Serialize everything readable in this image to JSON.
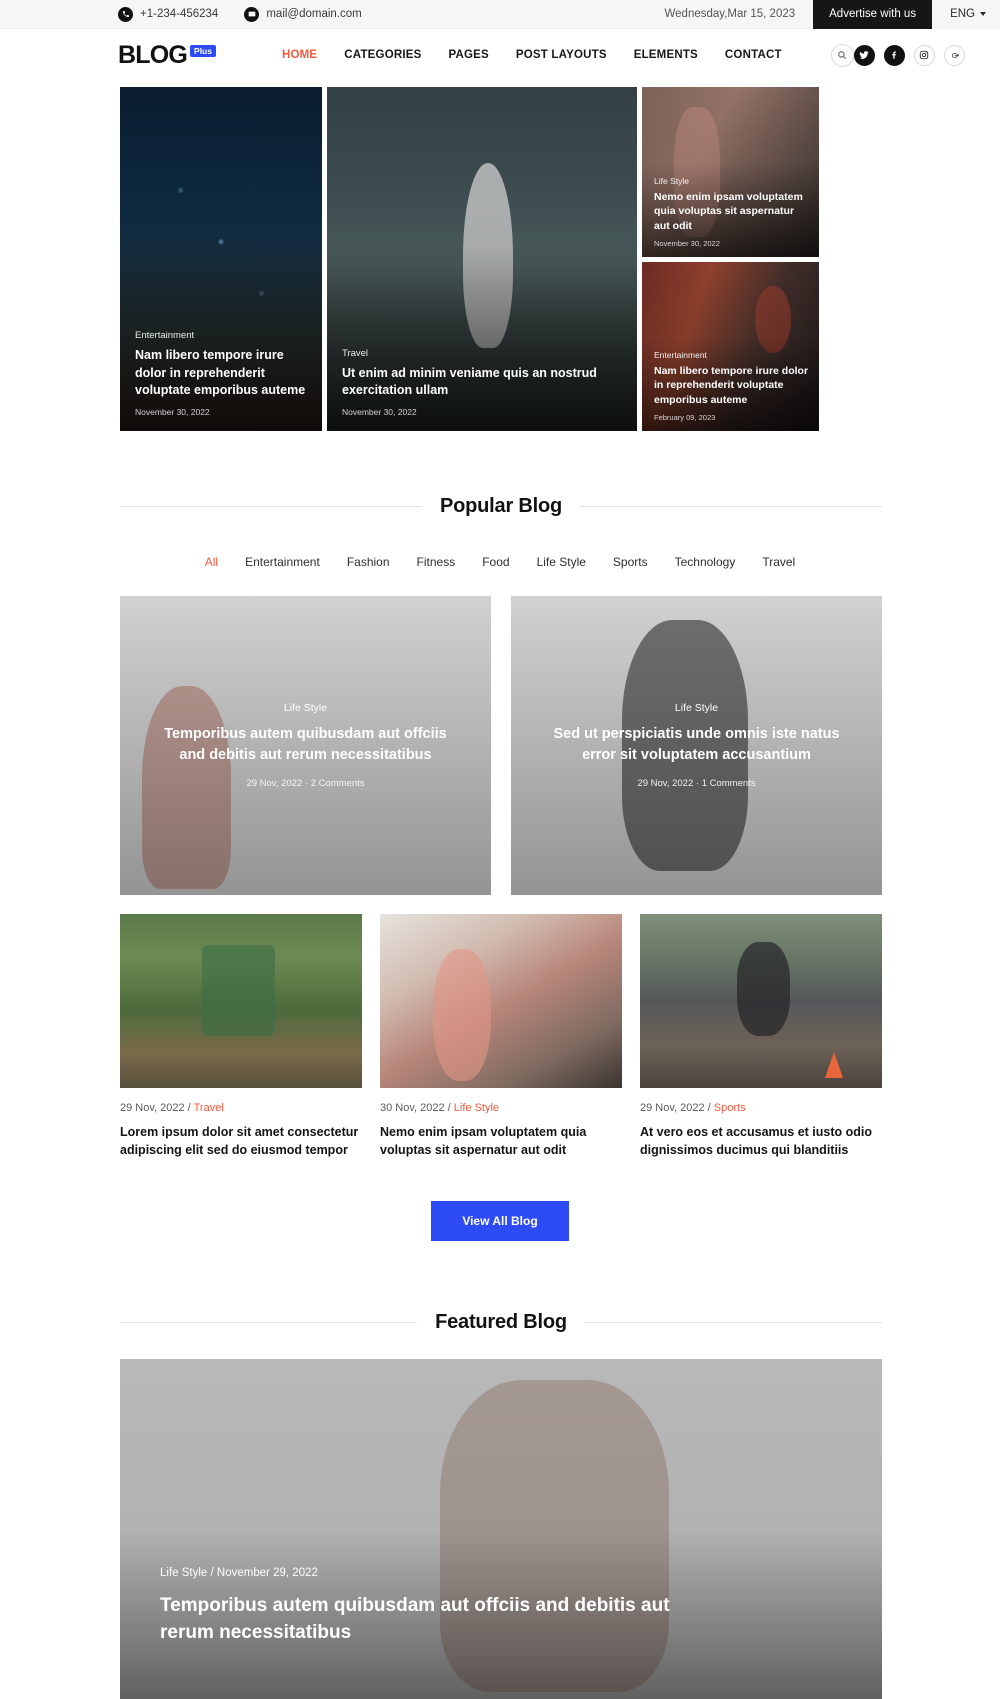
{
  "topbar": {
    "phone": "+1-234-456234",
    "email": "mail@domain.com",
    "date": "Wednesday,Mar 15, 2023",
    "advertise": "Advertise with us",
    "language": "ENG"
  },
  "nav": {
    "logo_text": "BLOG",
    "logo_badge": "Plus",
    "links": [
      {
        "label": "HOME",
        "active": true
      },
      {
        "label": "CATEGORIES",
        "active": false
      },
      {
        "label": "PAGES",
        "active": false
      },
      {
        "label": "POST LAYOUTS",
        "active": false
      },
      {
        "label": "ELEMENTS",
        "active": false
      },
      {
        "label": "CONTACT",
        "active": false
      }
    ],
    "social": [
      "twitter-icon",
      "facebook-icon",
      "instagram-icon",
      "google-plus-icon"
    ],
    "accent": "#f2593b",
    "brand": "#2d4cf5"
  },
  "hero": {
    "left": {
      "category": "Entertainment",
      "title": "Nam libero tempore irure dolor in reprehenderit voluptate emporibus auteme",
      "date": "November 30, 2022"
    },
    "middle": {
      "category": "Travel",
      "title": "Ut enim ad minim veniame quis an nostrud exercitation ullam",
      "date": "November 30, 2022"
    },
    "right_top": {
      "category": "Life Style",
      "title": "Nemo enim ipsam voluptatem quia voluptas sit aspernatur aut odit",
      "date": "November 30, 2022"
    },
    "right_bottom": {
      "category": "Entertainment",
      "title": "Nam libero tempore irure dolor in reprehenderit voluptate emporibus auteme",
      "date": "February 09, 2023"
    }
  },
  "popular": {
    "heading": "Popular Blog",
    "filters": [
      {
        "label": "All",
        "active": true
      },
      {
        "label": "Entertainment",
        "active": false
      },
      {
        "label": "Fashion",
        "active": false
      },
      {
        "label": "Fitness",
        "active": false
      },
      {
        "label": "Food",
        "active": false
      },
      {
        "label": "Life Style",
        "active": false
      },
      {
        "label": "Sports",
        "active": false
      },
      {
        "label": "Technology",
        "active": false
      },
      {
        "label": "Travel",
        "active": false
      }
    ],
    "big_cards": [
      {
        "category": "Life Style",
        "title": "Temporibus autem quibusdam aut offciis and debitis aut rerum necessitatibus",
        "meta": "29 Nov, 2022  ·  2 Comments"
      },
      {
        "category": "Life Style",
        "title": "Sed ut perspiciatis unde omnis iste natus error sit voluptatem accusantium",
        "meta": "29 Nov, 2022  ·  1 Comments"
      }
    ],
    "small_cards": [
      {
        "date": "29 Nov, 2022",
        "separator": " / ",
        "category": "Travel",
        "title": "Lorem ipsum dolor sit amet consectetur adipiscing elit sed do eiusmod tempor"
      },
      {
        "date": "30 Nov, 2022",
        "separator": " / ",
        "category": "Life Style",
        "title": "Nemo enim ipsam voluptatem quia voluptas sit aspernatur aut odit"
      },
      {
        "date": "29 Nov, 2022",
        "separator": " / ",
        "category": "Sports",
        "title": "At vero eos et accusamus et iusto odio dignissimos ducimus qui blanditiis"
      }
    ],
    "view_all_label": "View All Blog"
  },
  "featured": {
    "heading": "Featured Blog",
    "card": {
      "meta": "Life Style / November 29, 2022",
      "title": "Temporibus autem quibusdam aut offciis and debitis aut rerum necessitatibus"
    }
  }
}
